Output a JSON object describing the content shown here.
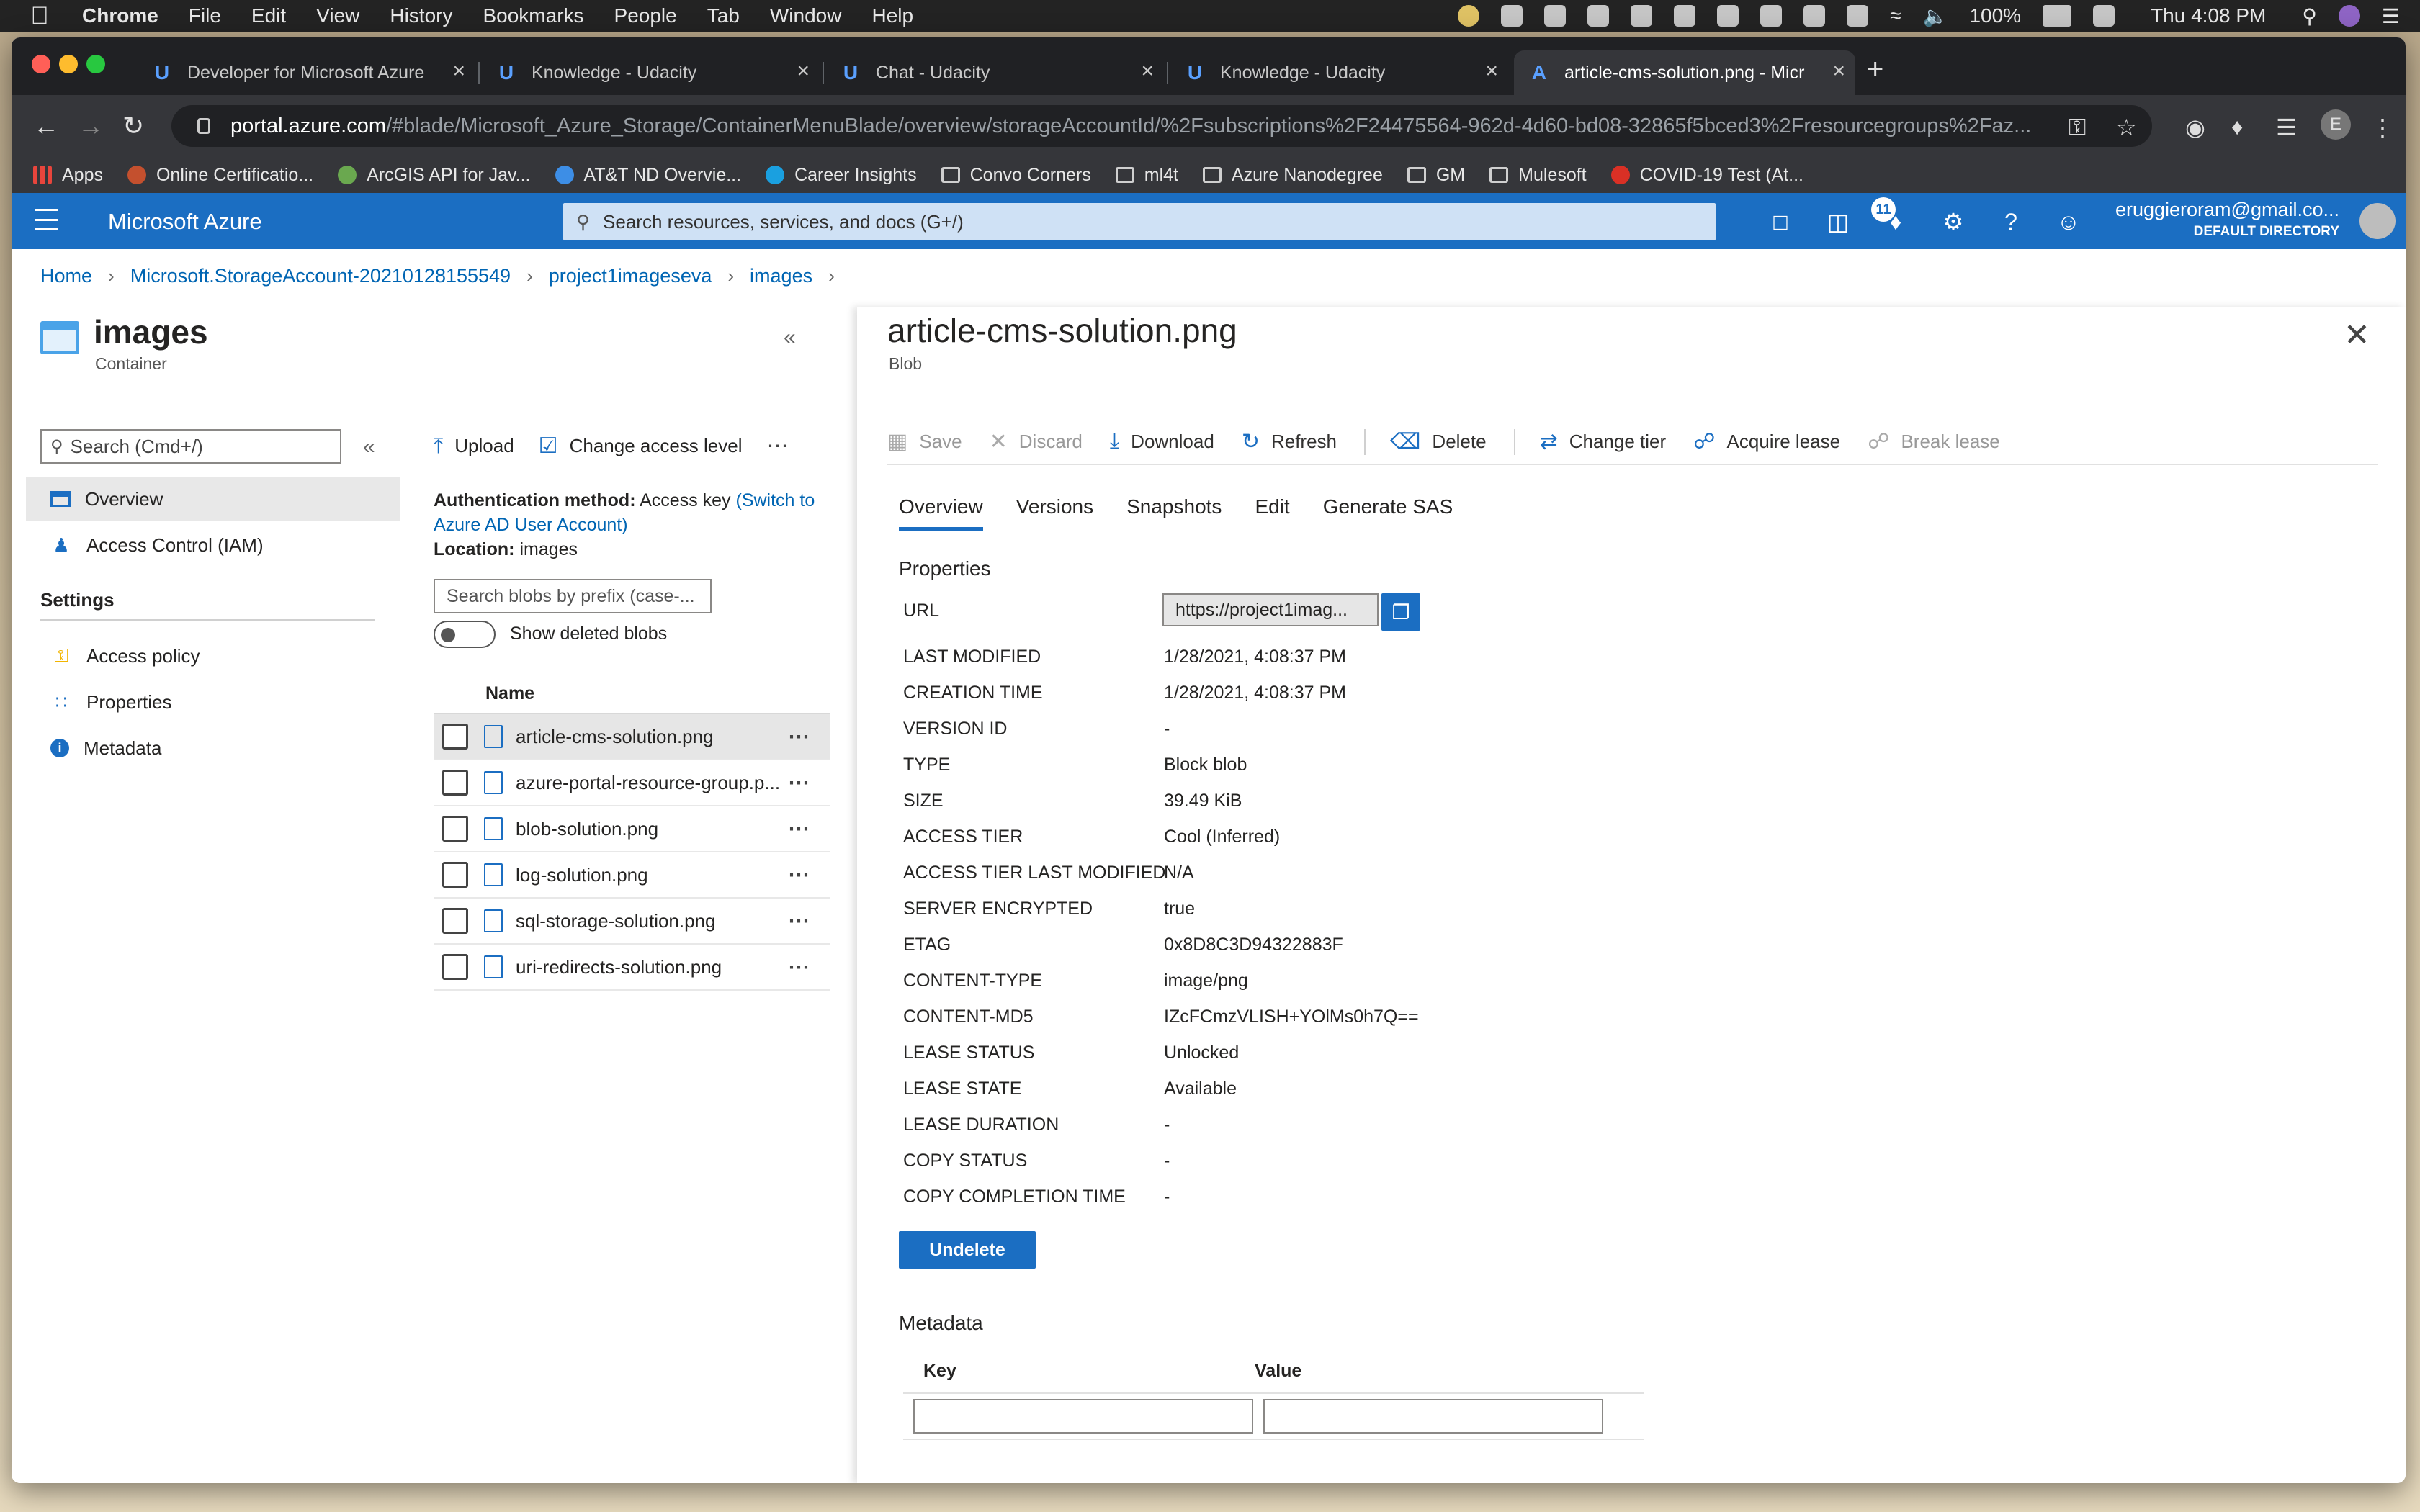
{
  "menubar": {
    "app": "Chrome",
    "items": [
      "File",
      "Edit",
      "View",
      "History",
      "Bookmarks",
      "People",
      "Tab",
      "Window",
      "Help"
    ],
    "battery": "100%",
    "clock": "Thu 4:08 PM"
  },
  "browser": {
    "tabs": [
      {
        "title": "Developer for Microsoft Azure",
        "icon": "udacity-icon"
      },
      {
        "title": "Knowledge - Udacity",
        "icon": "udacity-icon"
      },
      {
        "title": "Chat - Udacity",
        "icon": "udacity-icon"
      },
      {
        "title": "Knowledge - Udacity",
        "icon": "udacity-icon"
      },
      {
        "title": "article-cms-solution.png - Micr",
        "icon": "azure-icon"
      }
    ],
    "url_domain": "portal.azure.com",
    "url_path": "/#blade/Microsoft_Azure_Storage/ContainerMenuBlade/overview/storageAccountId/%2Fsubscriptions%2F24475564-962d-4d60-bd08-32865f5bced3%2Fresourcegroups%2Faz...",
    "profile_initial": "E",
    "bookmarks": [
      "Apps",
      "Online Certificatio...",
      "ArcGIS API for Jav...",
      "AT&T ND Overvie...",
      "Career Insights",
      "Convo Corners",
      "ml4t",
      "Azure Nanodegree",
      "GM",
      "Mulesoft",
      "COVID-19 Test (At..."
    ]
  },
  "azure": {
    "brand": "Microsoft Azure",
    "search_placeholder": "Search resources, services, and docs (G+/)",
    "notifications": "11",
    "account_email": "eruggieroram@gmail.co...",
    "account_directory": "DEFAULT DIRECTORY",
    "accent": "#1b6ec2"
  },
  "breadcrumb": [
    "Home",
    "Microsoft.StorageAccount-20210128155549",
    "project1imageseva",
    "images"
  ],
  "container": {
    "title": "images",
    "subtitle": "Container",
    "menu_search": "Search (Cmd+/)",
    "menu": {
      "overview": "Overview",
      "iam": "Access Control (IAM)",
      "settings_heading": "Settings",
      "access_policy": "Access policy",
      "properties": "Properties",
      "metadata": "Metadata"
    },
    "commands": {
      "upload": "Upload",
      "change_access": "Change access level"
    },
    "auth_label": "Authentication method:",
    "auth_value": "Access key",
    "auth_link": "(Switch to Azure AD User Account)",
    "location_label": "Location:",
    "location_value": "images",
    "prefix_placeholder": "Search blobs by prefix (case-...",
    "show_deleted": "Show deleted blobs",
    "name_header": "Name",
    "blobs": [
      "article-cms-solution.png",
      "azure-portal-resource-group.p...",
      "blob-solution.png",
      "log-solution.png",
      "sql-storage-solution.png",
      "uri-redirects-solution.png"
    ]
  },
  "blob": {
    "title": "article-cms-solution.png",
    "subtitle": "Blob",
    "commands": {
      "save": "Save",
      "discard": "Discard",
      "download": "Download",
      "refresh": "Refresh",
      "delete": "Delete",
      "change_tier": "Change tier",
      "acquire_lease": "Acquire lease",
      "break_lease": "Break lease"
    },
    "tabs": [
      "Overview",
      "Versions",
      "Snapshots",
      "Edit",
      "Generate SAS"
    ],
    "properties_title": "Properties",
    "url_label": "URL",
    "url_value": "https://project1imag...",
    "properties": [
      {
        "k": "LAST MODIFIED",
        "v": "1/28/2021, 4:08:37 PM"
      },
      {
        "k": "CREATION TIME",
        "v": "1/28/2021, 4:08:37 PM"
      },
      {
        "k": "VERSION ID",
        "v": "-"
      },
      {
        "k": "TYPE",
        "v": "Block blob"
      },
      {
        "k": "SIZE",
        "v": "39.49 KiB"
      },
      {
        "k": "ACCESS TIER",
        "v": "Cool (Inferred)"
      },
      {
        "k": "ACCESS TIER LAST MODIFIED",
        "v": "N/A"
      },
      {
        "k": "SERVER ENCRYPTED",
        "v": "true"
      },
      {
        "k": "ETAG",
        "v": "0x8D8C3D94322883F"
      },
      {
        "k": "CONTENT-TYPE",
        "v": "image/png"
      },
      {
        "k": "CONTENT-MD5",
        "v": "IZcFCmzVLISH+YOlMs0h7Q=="
      },
      {
        "k": "LEASE STATUS",
        "v": "Unlocked"
      },
      {
        "k": "LEASE STATE",
        "v": "Available"
      },
      {
        "k": "LEASE DURATION",
        "v": "-"
      },
      {
        "k": "COPY STATUS",
        "v": "-"
      },
      {
        "k": "COPY COMPLETION TIME",
        "v": "-"
      }
    ],
    "undelete": "Undelete",
    "metadata_title": "Metadata",
    "metadata_key": "Key",
    "metadata_value": "Value"
  }
}
